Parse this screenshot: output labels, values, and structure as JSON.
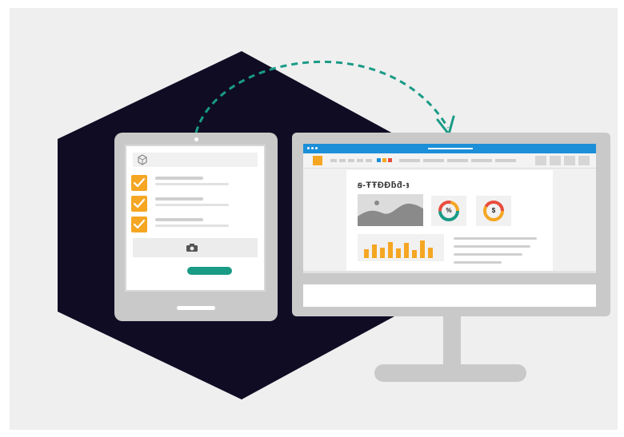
{
  "colors": {
    "background": "#efefef",
    "hexagon": "#0f0c24",
    "device_frame": "#c9c9c9",
    "checkbox": "#f5a623",
    "accent_green": "#1a9b86",
    "window_titlebar": "#1d8fd8",
    "bars": "#f5a623"
  },
  "icons": {
    "tablet_header": "cube-icon",
    "check": "checkmark-icon",
    "photo": "camera-icon",
    "kpi_1": "percent-icon",
    "kpi_2": "dollar-icon",
    "image": "landscape-image-icon"
  },
  "tablet_form": {
    "checklist_count_checked": 3,
    "submit_button_label": ""
  },
  "report": {
    "title": "ꞩ‑ŦŦƉƉƃƌ‑ꜣ",
    "kpi_1_symbol": "%",
    "kpi_2_symbol": "$",
    "bar_levels": [
      0.45,
      0.7,
      0.55,
      0.85,
      0.5,
      0.8,
      0.4,
      0.9,
      0.55
    ]
  }
}
